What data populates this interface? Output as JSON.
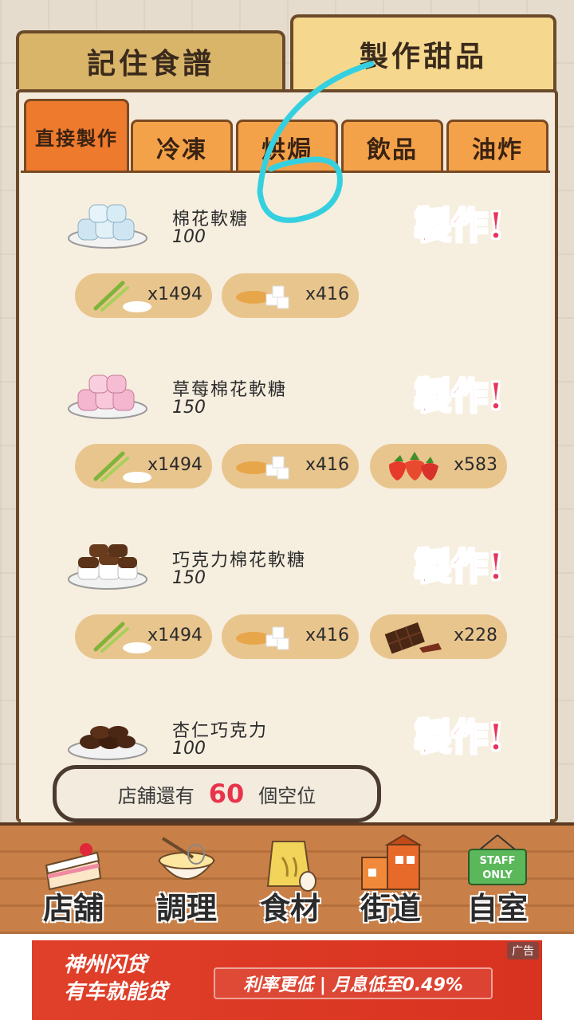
{
  "top_tabs": [
    {
      "label": "記住食譜",
      "active": false
    },
    {
      "label": "製作甜品",
      "active": true
    }
  ],
  "sub_tabs": [
    {
      "label": "直接製作",
      "active": true
    },
    {
      "label": "冷凍",
      "active": false
    },
    {
      "label": "烘焗",
      "active": false
    },
    {
      "label": "飲品",
      "active": false
    },
    {
      "label": "油炸",
      "active": false
    }
  ],
  "recipes": [
    {
      "name": "棉花軟糖",
      "price": "100",
      "make_label": "製作!",
      "ingredients": [
        {
          "icon": "green-onion-sugar-icon",
          "qty": "x1494"
        },
        {
          "icon": "grain-sugar-cubes-icon",
          "qty": "x416"
        }
      ]
    },
    {
      "name": "草莓棉花軟糖",
      "price": "150",
      "make_label": "製作!",
      "ingredients": [
        {
          "icon": "green-onion-sugar-icon",
          "qty": "x1494"
        },
        {
          "icon": "grain-sugar-cubes-icon",
          "qty": "x416"
        },
        {
          "icon": "strawberry-icon",
          "qty": "x583"
        }
      ]
    },
    {
      "name": "巧克力棉花軟糖",
      "price": "150",
      "make_label": "製作!",
      "ingredients": [
        {
          "icon": "green-onion-sugar-icon",
          "qty": "x1494"
        },
        {
          "icon": "grain-sugar-cubes-icon",
          "qty": "x416"
        },
        {
          "icon": "chocolate-bar-icon",
          "qty": "x228"
        }
      ]
    },
    {
      "name": "杏仁巧克力",
      "price": "100",
      "make_label": "製作!",
      "ingredients": []
    }
  ],
  "slots": {
    "prefix": "店舖還有",
    "count": "60",
    "suffix": "個空位"
  },
  "nav": [
    {
      "label": "店舖",
      "icon": "cake-slice-icon"
    },
    {
      "label": "調理",
      "icon": "mixing-bowl-icon"
    },
    {
      "label": "食材",
      "icon": "flour-sack-icon"
    },
    {
      "label": "街道",
      "icon": "street-shops-icon"
    },
    {
      "label": "自室",
      "icon": "staff-only-sign-icon"
    }
  ],
  "staff_sign_text": "STAFF ONLY",
  "ad": {
    "brand_line1": "神州闪贷",
    "brand_line2": "有车就能贷",
    "slogan": "利率更低 | 月息低至0.49%",
    "tag": "广告"
  },
  "colors": {
    "make_button": "#e8335a",
    "active_sub_tab": "#ee7a2e",
    "sub_tab": "#f4a24a",
    "ingredient_pill": "#e9c58e",
    "scribble": "#35d0e0"
  }
}
